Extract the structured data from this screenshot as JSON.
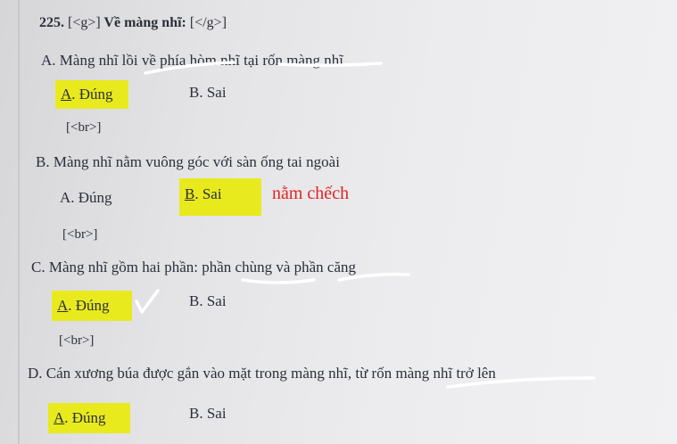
{
  "question": {
    "number": "225.",
    "tag_open": "[<g>]",
    "title": "Về màng nhĩ:",
    "tag_close": "[</g>]"
  },
  "br_tag": "[<br>]",
  "items": [
    {
      "statement": "A. Màng nhĩ lồi về phía hòm nhĩ tại rốn màng nhĩ",
      "true_letter": "A",
      "true_rest": ". Đúng",
      "false_letter": "B",
      "false_rest": ". Sai",
      "selected": "true"
    },
    {
      "statement": "B. Màng nhĩ nằm vuông góc với sàn ống tai ngoài",
      "true_letter": "A",
      "true_rest": ". Đúng",
      "false_letter": "B",
      "false_rest": ". Sai",
      "selected": "false",
      "handwritten_note": "nằm chếch"
    },
    {
      "statement": "C. Màng nhĩ gồm hai phần: phần chùng và phần căng",
      "true_letter": "A",
      "true_rest": ". Đúng",
      "false_letter": "B",
      "false_rest": ". Sai",
      "selected": "true"
    },
    {
      "statement": "D. Cán xương búa được gắn vào mặt trong màng nhĩ, từ rốn màng nhĩ trở lên",
      "true_letter": "A",
      "true_rest": ". Đúng",
      "false_letter": "B",
      "false_rest": ". Sai",
      "selected": "true"
    }
  ],
  "colors": {
    "highlight": "#e8ea1e",
    "pen_white": "#ffffff",
    "note_red": "#e22222"
  },
  "icons": [
    "checkmark-icon"
  ]
}
